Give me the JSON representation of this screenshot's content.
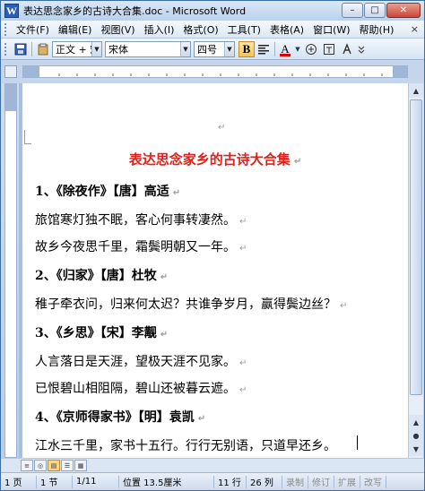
{
  "window": {
    "title": "表达思念家乡的古诗大合集.doc - Microsoft Word",
    "app_icon": "W",
    "minimize": "–",
    "maximize": "□",
    "close": "✕"
  },
  "menu": {
    "items": [
      "文件(F)",
      "编辑(E)",
      "视图(V)",
      "插入(I)",
      "格式(O)",
      "工具(T)",
      "表格(A)",
      "窗口(W)",
      "帮助(H)"
    ],
    "close_doc": "×"
  },
  "toolbar": {
    "style_value": "正文 + 宋体",
    "font_value": "宋体",
    "size_value": "四号",
    "bold_label": "B",
    "font_color_label": "A",
    "icons": [
      "save-icon",
      "paste-icon",
      "bold-icon",
      "align-left-icon",
      "font-color-icon",
      "phonetic-icon",
      "enclosed-char-icon",
      "char-shading-icon"
    ]
  },
  "document": {
    "title": "表达思念家乡的古诗大合集",
    "lines": [
      {
        "text": "1、《除夜作》【唐】高适",
        "bold": true
      },
      {
        "text": "旅馆寒灯独不眠，客心何事转凄然。",
        "bold": false
      },
      {
        "text": "故乡今夜思千里，霜鬓明朝又一年。",
        "bold": false
      },
      {
        "text": "2、《归家》【唐】杜牧",
        "bold": true
      },
      {
        "text": "稚子牵衣问，归来何太迟？共谁争岁月，赢得鬓边丝？",
        "bold": false
      },
      {
        "text": "3、《乡思》【宋】李觏",
        "bold": true
      },
      {
        "text": "人言落日是天涯，望极天涯不见家。",
        "bold": false
      },
      {
        "text": "已恨碧山相阻隔，碧山还被暮云遮。",
        "bold": false
      },
      {
        "text": "4、《京师得家书》【明】袁凯",
        "bold": true
      },
      {
        "text": "江水三千里，家书十五行。行行无别语，只道早还乡。",
        "bold": false
      }
    ],
    "paragraph_mark": "↵"
  },
  "statusbar": {
    "page": "1 页",
    "section": "1 节",
    "page_of": "1/11",
    "position": "位置 13.5厘米",
    "line": "11 行",
    "column": "26 列",
    "rec": "录制",
    "trk": "修订",
    "ext": "扩展",
    "ovr": "改写"
  }
}
